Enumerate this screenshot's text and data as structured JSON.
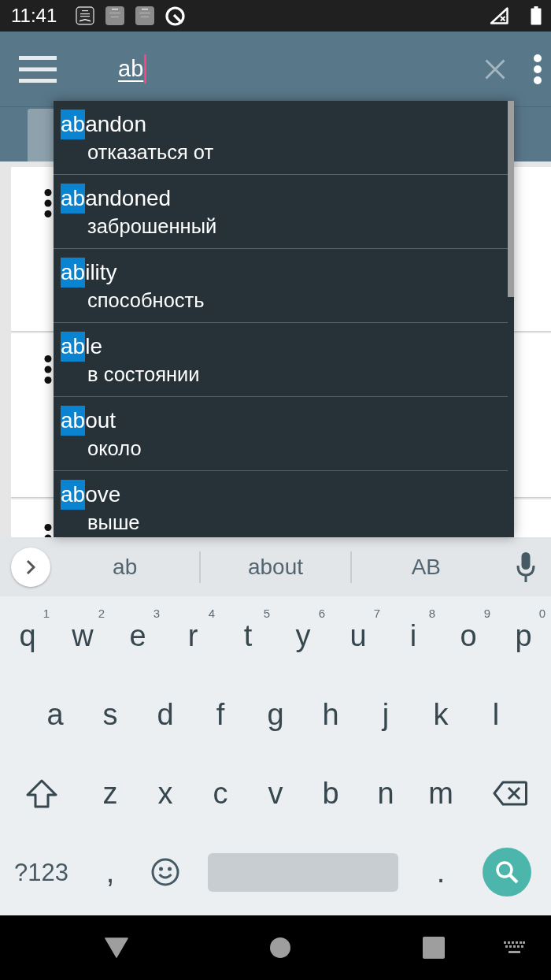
{
  "status_bar": {
    "time": "11:41"
  },
  "search": {
    "query": "ab"
  },
  "dropdown": {
    "items": [
      {
        "match": "ab",
        "rest": "andon",
        "translation": "отказаться от"
      },
      {
        "match": "ab",
        "rest": "andoned",
        "translation": "заброшенный"
      },
      {
        "match": "ab",
        "rest": "ility",
        "translation": "способность"
      },
      {
        "match": "ab",
        "rest": "le",
        "translation": "в состоянии"
      },
      {
        "match": "ab",
        "rest": "out",
        "translation": "около"
      },
      {
        "match": "ab",
        "rest": "ove",
        "translation": "выше"
      }
    ]
  },
  "keyboard": {
    "suggestions": [
      "ab",
      "about",
      "AB"
    ],
    "rows": [
      [
        {
          "kind": "char",
          "label": "q",
          "hint": "1"
        },
        {
          "kind": "char",
          "label": "w",
          "hint": "2"
        },
        {
          "kind": "char",
          "label": "e",
          "hint": "3"
        },
        {
          "kind": "char",
          "label": "r",
          "hint": "4"
        },
        {
          "kind": "char",
          "label": "t",
          "hint": "5"
        },
        {
          "kind": "char",
          "label": "y",
          "hint": "6"
        },
        {
          "kind": "char",
          "label": "u",
          "hint": "7"
        },
        {
          "kind": "char",
          "label": "i",
          "hint": "8"
        },
        {
          "kind": "char",
          "label": "o",
          "hint": "9"
        },
        {
          "kind": "char",
          "label": "p",
          "hint": "0"
        }
      ],
      [
        {
          "kind": "char",
          "label": "a"
        },
        {
          "kind": "char",
          "label": "s"
        },
        {
          "kind": "char",
          "label": "d"
        },
        {
          "kind": "char",
          "label": "f"
        },
        {
          "kind": "char",
          "label": "g"
        },
        {
          "kind": "char",
          "label": "h"
        },
        {
          "kind": "char",
          "label": "j"
        },
        {
          "kind": "char",
          "label": "k"
        },
        {
          "kind": "char",
          "label": "l"
        }
      ],
      [
        {
          "kind": "shift"
        },
        {
          "kind": "char",
          "label": "z"
        },
        {
          "kind": "char",
          "label": "x"
        },
        {
          "kind": "char",
          "label": "c"
        },
        {
          "kind": "char",
          "label": "v"
        },
        {
          "kind": "char",
          "label": "b"
        },
        {
          "kind": "char",
          "label": "n"
        },
        {
          "kind": "char",
          "label": "m"
        },
        {
          "kind": "backspace"
        }
      ]
    ],
    "bottom_row": {
      "symbols_key": "?123",
      "left_key": ",",
      "right_key": "."
    }
  }
}
